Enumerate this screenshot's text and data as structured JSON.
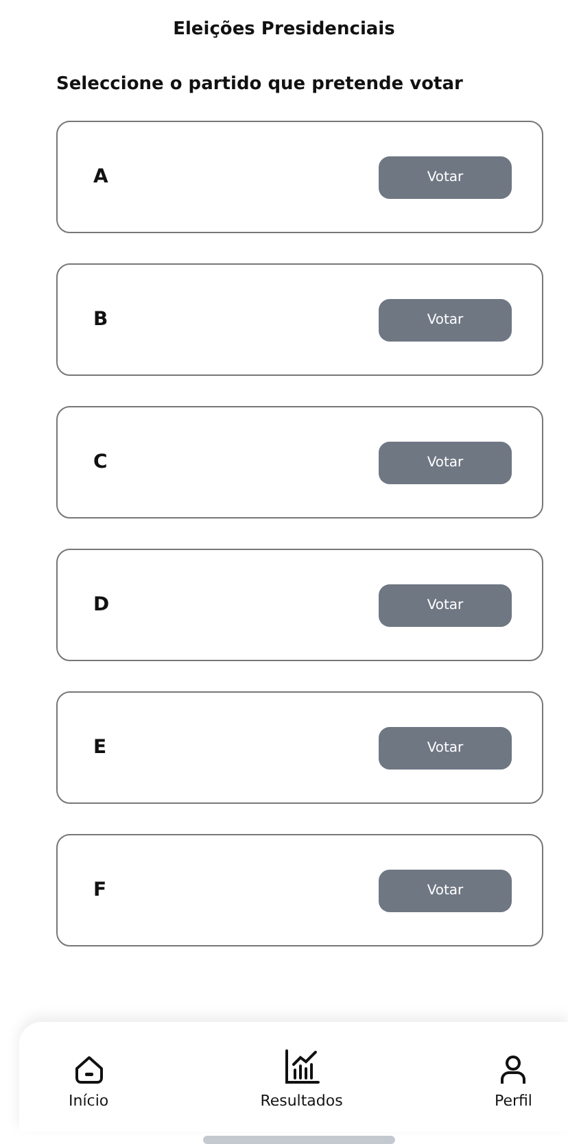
{
  "title": "Eleições Presidenciais",
  "subtitle": "Seleccione o partido que pretende votar",
  "parties": [
    {
      "name": "A",
      "button": "Votar"
    },
    {
      "name": "B",
      "button": "Votar"
    },
    {
      "name": "C",
      "button": "Votar"
    },
    {
      "name": "D",
      "button": "Votar"
    },
    {
      "name": "E",
      "button": "Votar"
    },
    {
      "name": "F",
      "button": "Votar"
    }
  ],
  "nav": [
    {
      "kind": "home",
      "label": "Início"
    },
    {
      "kind": "chart",
      "label": "Resultados"
    },
    {
      "kind": "profile",
      "label": "Perfil"
    }
  ]
}
